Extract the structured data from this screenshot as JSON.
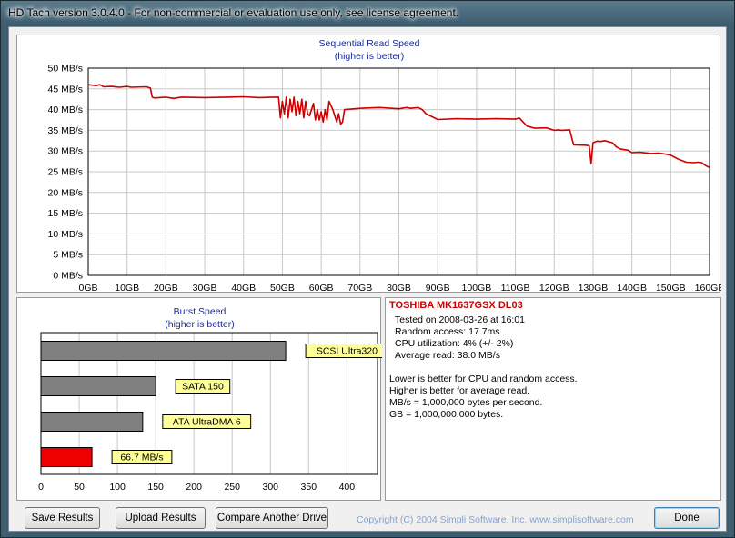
{
  "window": {
    "title": "HD Tach version 3.0.4.0  - For non-commercial or evaluation use only, see license agreement."
  },
  "chart_data": [
    {
      "type": "line",
      "title": "Sequential Read Speed",
      "subtitle": "(higher is better)",
      "x_unit": "GB",
      "y_unit": "MB/s",
      "xlim": [
        0,
        160
      ],
      "ylim": [
        0,
        50
      ],
      "x_ticks": [
        "0GB",
        "10GB",
        "20GB",
        "30GB",
        "40GB",
        "50GB",
        "60GB",
        "70GB",
        "80GB",
        "90GB",
        "100GB",
        "110GB",
        "120GB",
        "130GB",
        "140GB",
        "150GB",
        "160GB"
      ],
      "y_ticks": [
        "0 MB/s",
        "5 MB/s",
        "10 MB/s",
        "15 MB/s",
        "20 MB/s",
        "25 MB/s",
        "30 MB/s",
        "35 MB/s",
        "40 MB/s",
        "45 MB/s",
        "50 MB/s"
      ],
      "grid": true,
      "color": "#cc0000",
      "x": [
        0,
        2,
        3,
        4,
        6,
        8,
        10,
        11,
        15,
        16,
        16.5,
        17,
        20,
        22,
        24,
        30,
        36,
        40,
        44,
        48,
        49,
        49.5,
        50,
        50.5,
        51,
        51.5,
        52,
        52.5,
        53,
        53.5,
        54,
        54.5,
        55,
        55.5,
        56,
        56.5,
        57,
        58,
        58.5,
        59,
        59.5,
        60,
        60.5,
        61,
        61.5,
        62,
        63,
        64,
        64.5,
        65,
        65.5,
        66,
        70,
        75,
        80,
        82,
        83,
        85,
        86,
        87,
        90,
        95,
        100,
        105,
        110,
        111,
        113,
        115,
        118,
        120,
        121,
        122,
        124,
        125,
        128,
        129,
        129.5,
        130,
        130.5,
        131,
        132,
        133,
        135,
        136,
        137,
        139,
        140,
        142,
        145,
        147,
        149,
        150,
        151,
        152,
        154,
        156,
        157,
        158,
        159,
        160
      ],
      "y": [
        46,
        45.8,
        46,
        45.5,
        45.6,
        45.4,
        45.6,
        45.4,
        45.5,
        45.2,
        43,
        42.8,
        43,
        42.7,
        43,
        42.9,
        43,
        43.1,
        42.9,
        43,
        43,
        38,
        42,
        39,
        43,
        38,
        42.5,
        39.5,
        43,
        38.5,
        42,
        39,
        42.5,
        38,
        42,
        39,
        38.5,
        41.5,
        37.5,
        40,
        37.5,
        39.5,
        37,
        40,
        37.5,
        42,
        40,
        37,
        39,
        36.5,
        37,
        40,
        40.3,
        40.5,
        40.2,
        40.5,
        40.3,
        40.5,
        40,
        39,
        37.6,
        37.8,
        37.7,
        37.8,
        37.7,
        38,
        36,
        35.5,
        35.6,
        35,
        35.1,
        35,
        35.1,
        31.5,
        31.4,
        31.3,
        27,
        32,
        32.2,
        32.4,
        32.3,
        32.5,
        32,
        31,
        30.5,
        30.2,
        29.6,
        29.7,
        29.4,
        29.5,
        29.2,
        29,
        28.5,
        28,
        27.3,
        27.2,
        27.3,
        27.2,
        26.5,
        26,
        26.2,
        25.5
      ]
    },
    {
      "type": "bar",
      "orientation": "horizontal",
      "title": "Burst Speed",
      "subtitle": "(higher is better)",
      "xlim": [
        0,
        440
      ],
      "x_ticks": [
        "0",
        "50",
        "100",
        "150",
        "200",
        "250",
        "300",
        "350",
        "400"
      ],
      "categories": [
        "SCSI Ultra320",
        "SATA 150",
        "ATA UltraDMA 6",
        "66.7 MB/s"
      ],
      "values": [
        320,
        150,
        133,
        66.7
      ],
      "colors": [
        "#808080",
        "#808080",
        "#808080",
        "#ee0000"
      ]
    }
  ],
  "info": {
    "drive": "TOSHIBA MK1637GSX DL03",
    "tested": "Tested on 2008-03-26 at 16:01",
    "random_access": "Random access: 17.7ms",
    "cpu": "CPU utilization: 4% (+/- 2%)",
    "avg_read": "Average read: 38.0 MB/s",
    "notes": [
      "Lower is better for CPU and random access.",
      "Higher is better for average read.",
      "MB/s = 1,000,000 bytes per second.",
      "GB = 1,000,000,000 bytes."
    ]
  },
  "buttons": {
    "save": "Save Results",
    "upload": "Upload Results",
    "compare": "Compare Another Drive",
    "done": "Done"
  },
  "copyright": "Copyright (C) 2004 Simpli Software, Inc. www.simplisoftware.com"
}
